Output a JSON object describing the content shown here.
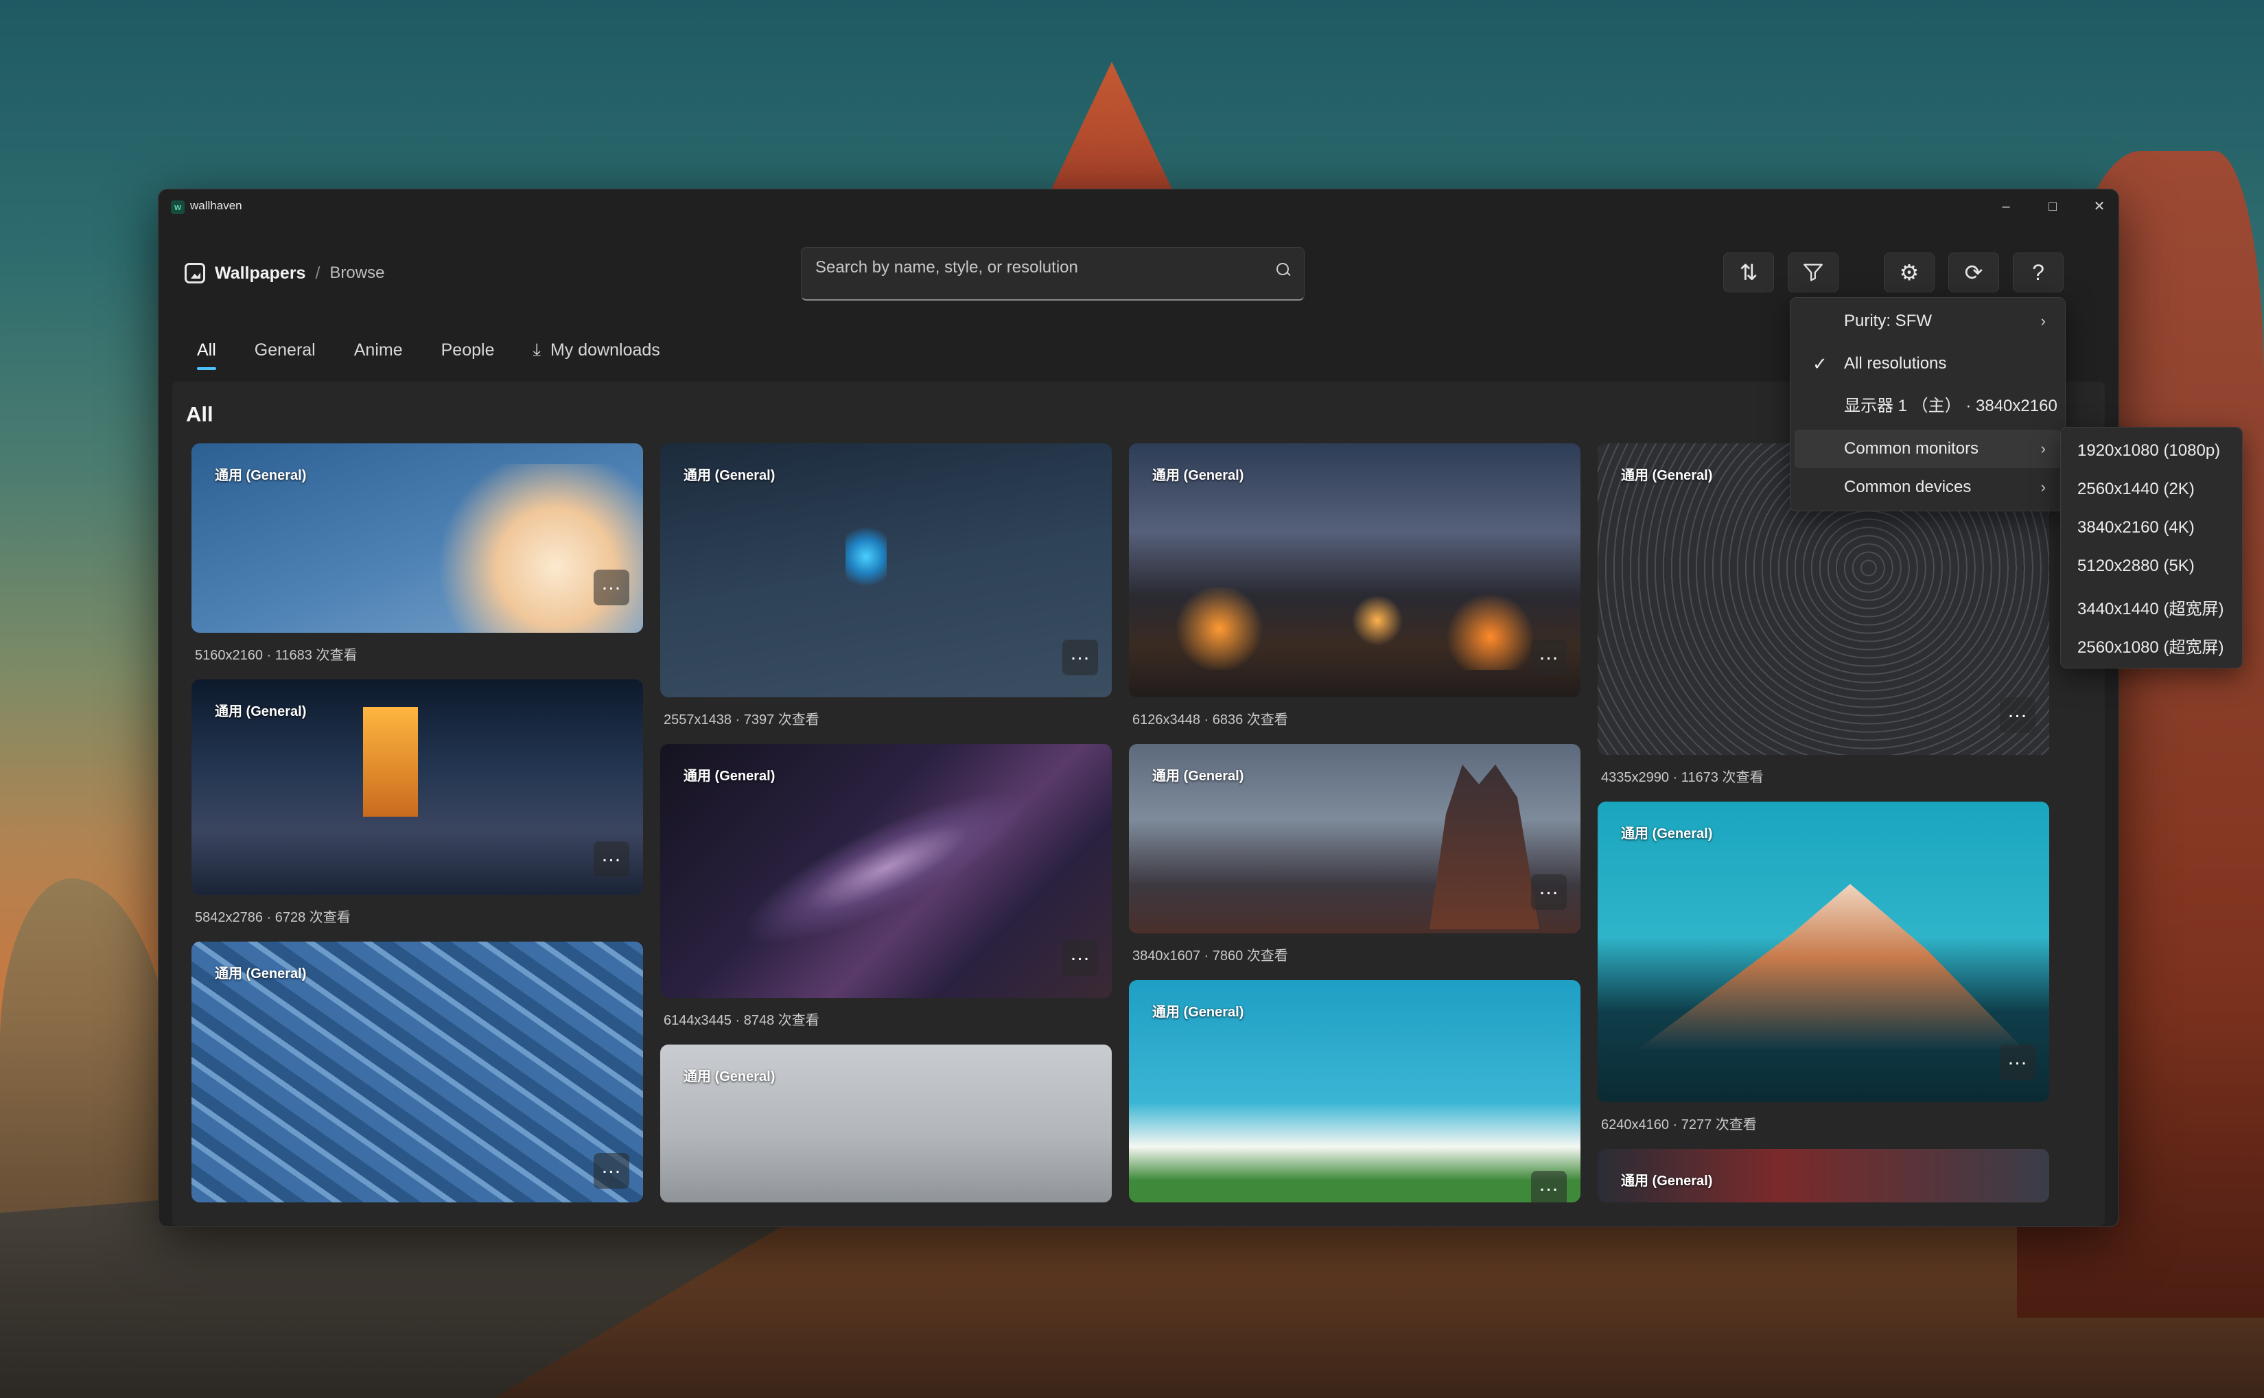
{
  "window": {
    "app_name": "wallhaven"
  },
  "breadcrumb": {
    "title": "Wallpapers",
    "separator": "/",
    "sub": "Browse"
  },
  "search": {
    "placeholder": "Search by name, style, or resolution"
  },
  "tabs": [
    {
      "label": "All",
      "active": true
    },
    {
      "label": "General"
    },
    {
      "label": "Anime"
    },
    {
      "label": "People"
    },
    {
      "label": "My downloads"
    }
  ],
  "section_title": "All",
  "cards": [
    {
      "tag": "通用 (General)",
      "meta": "5160x2160 · 11683 次查看"
    },
    {
      "tag": "通用 (General)",
      "meta": "5842x2786 · 6728 次查看"
    },
    {
      "tag": "通用 (General)",
      "meta": ""
    },
    {
      "tag": "通用 (General)",
      "meta": "2557x1438 · 7397 次查看"
    },
    {
      "tag": "通用 (General)",
      "meta": "6144x3445 · 8748 次查看"
    },
    {
      "tag": "通用 (General)",
      "meta": ""
    },
    {
      "tag": "通用 (General)",
      "meta": "6126x3448 · 6836 次查看"
    },
    {
      "tag": "通用 (General)",
      "meta": "3840x1607 · 7860 次查看"
    },
    {
      "tag": "通用 (General)",
      "meta": ""
    },
    {
      "tag": "通用 (General)",
      "meta": "4335x2990 · 11673 次查看"
    },
    {
      "tag": "通用 (General)",
      "meta": "6240x4160 · 7277 次查看"
    },
    {
      "tag": "通用 (General)",
      "meta": ""
    }
  ],
  "filter_menu": {
    "items": [
      {
        "label": "Purity: SFW",
        "submenu": true
      },
      {
        "label": "All resolutions",
        "checked": true
      },
      {
        "label": "显示器 1 （主） · 3840x2160"
      },
      {
        "label": "Common monitors",
        "submenu": true
      },
      {
        "label": "Common devices",
        "submenu": true
      }
    ]
  },
  "monitor_submenu": {
    "items": [
      "1920x1080 (1080p)",
      "2560x1440 (2K)",
      "3840x2160 (4K)",
      "5120x2880 (5K)",
      "3440x1440 (超宽屏)",
      "2560x1080 (超宽屏)"
    ]
  }
}
